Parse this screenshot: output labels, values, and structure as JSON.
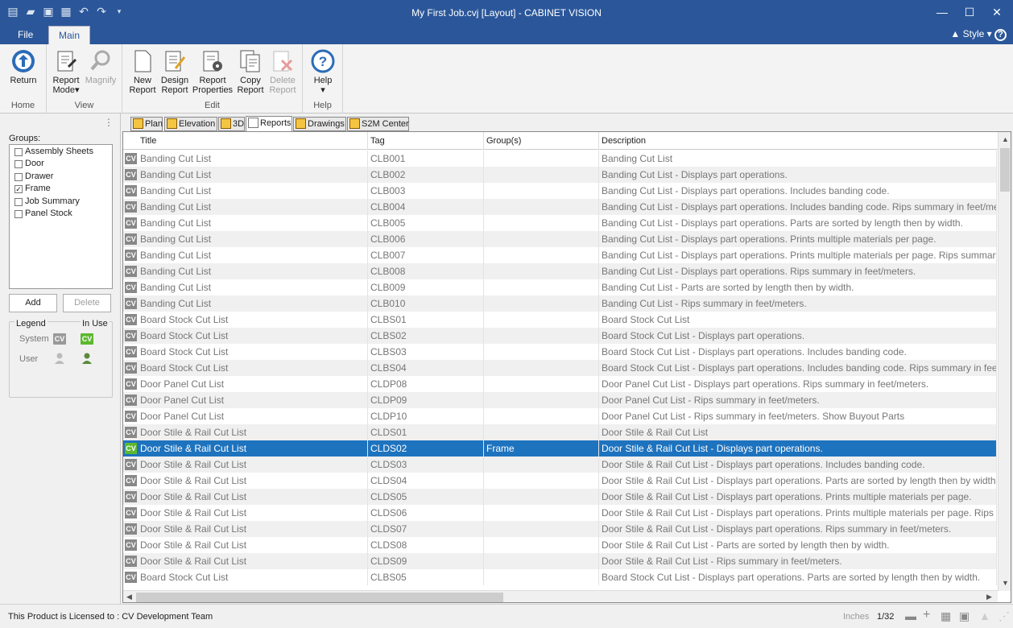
{
  "window": {
    "title": "My First Job.cvj [Layout] - CABINET VISION",
    "qat_icons": [
      "new-icon",
      "open-icon",
      "save-icon",
      "print-icon",
      "undo-icon",
      "redo-icon",
      "customize-icon"
    ],
    "controls": {
      "minimize": "—",
      "maximize": "☐",
      "close": "✕"
    }
  },
  "ribbon_tabs": [
    "File",
    "Main"
  ],
  "style_label": "Style",
  "ribbon": {
    "home": {
      "label": "Home",
      "return": "Return"
    },
    "view": {
      "label": "View",
      "report_mode_1": "Report",
      "report_mode_2": "Mode",
      "magnify": "Magnify"
    },
    "edit": {
      "label": "Edit",
      "new_1": "New",
      "new_2": "Report",
      "design_1": "Design",
      "design_2": "Report",
      "props_1": "Report",
      "props_2": "Properties",
      "copy_1": "Copy",
      "copy_2": "Report",
      "delete_1": "Delete",
      "delete_2": "Report"
    },
    "help": {
      "label": "Help",
      "help": "Help"
    }
  },
  "sidebar": {
    "groups_label": "Groups:",
    "groups": [
      {
        "label": "Assembly Sheets",
        "checked": false
      },
      {
        "label": "Door",
        "checked": false
      },
      {
        "label": "Drawer",
        "checked": false
      },
      {
        "label": "Frame",
        "checked": true
      },
      {
        "label": "Job Summary",
        "checked": false
      },
      {
        "label": "Panel Stock",
        "checked": false
      }
    ],
    "add": "Add",
    "delete": "Delete",
    "legend": {
      "title": "Legend",
      "in_use": "In Use",
      "system": "System",
      "user": "User",
      "cv": "CV"
    }
  },
  "view_tabs": [
    "Plan",
    "Elevation",
    "3D",
    "Reports",
    "Drawings",
    "S2M Center"
  ],
  "table": {
    "columns": [
      "Title",
      "Tag",
      "Group(s)",
      "Description"
    ],
    "rows": [
      {
        "title": "Banding Cut List",
        "tag": "CLB001",
        "group": "",
        "desc": "Banding Cut List"
      },
      {
        "title": "Banding Cut List",
        "tag": "CLB002",
        "group": "",
        "desc": "Banding Cut List - Displays part operations."
      },
      {
        "title": "Banding Cut List",
        "tag": "CLB003",
        "group": "",
        "desc": "Banding Cut List - Displays part operations.  Includes banding code."
      },
      {
        "title": "Banding Cut List",
        "tag": "CLB004",
        "group": "",
        "desc": "Banding Cut List - Displays part operations.  Includes banding code. Rips summary in feet/met"
      },
      {
        "title": "Banding Cut List",
        "tag": "CLB005",
        "group": "",
        "desc": "Banding Cut List - Displays part operations.  Parts are sorted by length then by width."
      },
      {
        "title": "Banding Cut List",
        "tag": "CLB006",
        "group": "",
        "desc": "Banding Cut List - Displays part operations.  Prints multiple materials per page."
      },
      {
        "title": "Banding Cut List",
        "tag": "CLB007",
        "group": "",
        "desc": "Banding Cut List - Displays part operations.  Prints multiple materials per page. Rips summary"
      },
      {
        "title": "Banding Cut List",
        "tag": "CLB008",
        "group": "",
        "desc": "Banding Cut List - Displays part operations. Rips summary in feet/meters."
      },
      {
        "title": "Banding Cut List",
        "tag": "CLB009",
        "group": "",
        "desc": "Banding Cut List - Parts are sorted by length then by width."
      },
      {
        "title": "Banding Cut List",
        "tag": "CLB010",
        "group": "",
        "desc": "Banding Cut List - Rips summary in feet/meters."
      },
      {
        "title": "Board Stock Cut List",
        "tag": "CLBS01",
        "group": "",
        "desc": "Board Stock Cut List"
      },
      {
        "title": "Board Stock Cut List",
        "tag": "CLBS02",
        "group": "",
        "desc": "Board Stock Cut List - Displays part operations."
      },
      {
        "title": "Board Stock Cut List",
        "tag": "CLBS03",
        "group": "",
        "desc": "Board Stock Cut List - Displays part operations.  Includes banding code."
      },
      {
        "title": "Board Stock Cut List",
        "tag": "CLBS04",
        "group": "",
        "desc": "Board Stock Cut List - Displays part operations.  Includes banding code. Rips summary in feet/"
      },
      {
        "title": "Door Panel Cut List",
        "tag": "CLDP08",
        "group": "",
        "desc": "Door Panel Cut List - Displays part operations. Rips summary in feet/meters."
      },
      {
        "title": "Door Panel Cut List",
        "tag": "CLDP09",
        "group": "",
        "desc": "Door Panel Cut List - Rips summary in feet/meters."
      },
      {
        "title": "Door Panel Cut List",
        "tag": "CLDP10",
        "group": "",
        "desc": "Door Panel Cut List - Rips summary in feet/meters.  Show Buyout Parts"
      },
      {
        "title": "Door Stile & Rail Cut List",
        "tag": "CLDS01",
        "group": "",
        "desc": "Door Stile & Rail Cut List"
      },
      {
        "title": "Door Stile & Rail Cut List",
        "tag": "CLDS02",
        "group": "Frame",
        "desc": "Door Stile & Rail Cut List - Displays part operations.",
        "selected": true
      },
      {
        "title": "Door Stile & Rail Cut List",
        "tag": "CLDS03",
        "group": "",
        "desc": "Door Stile & Rail Cut List - Displays part operations.  Includes banding code."
      },
      {
        "title": "Door Stile & Rail Cut List",
        "tag": "CLDS04",
        "group": "",
        "desc": "Door Stile & Rail Cut List - Displays part operations.  Parts are sorted by length then by width."
      },
      {
        "title": "Door Stile & Rail Cut List",
        "tag": "CLDS05",
        "group": "",
        "desc": "Door Stile & Rail Cut List - Displays part operations.  Prints multiple materials per page."
      },
      {
        "title": "Door Stile & Rail Cut List",
        "tag": "CLDS06",
        "group": "",
        "desc": "Door Stile & Rail Cut List - Displays part operations.  Prints multiple materials per page. Rips s"
      },
      {
        "title": "Door Stile & Rail Cut List",
        "tag": "CLDS07",
        "group": "",
        "desc": "Door Stile & Rail Cut List - Displays part operations. Rips summary in feet/meters."
      },
      {
        "title": "Door Stile & Rail Cut List",
        "tag": "CLDS08",
        "group": "",
        "desc": "Door Stile & Rail Cut List - Parts are sorted by length then by width."
      },
      {
        "title": "Door Stile & Rail Cut List",
        "tag": "CLDS09",
        "group": "",
        "desc": "Door Stile & Rail Cut List - Rips summary in feet/meters."
      },
      {
        "title": "Board Stock Cut List",
        "tag": "CLBS05",
        "group": "",
        "desc": "Board Stock Cut List - Displays part operations.  Parts are sorted by length then by width."
      }
    ],
    "cv": "CV"
  },
  "status": {
    "license": "This Product is Licensed to : CV Development Team",
    "units": "Inches",
    "scale": "1/32"
  },
  "colors": {
    "accent": "#2b579a",
    "selection": "#1e73be",
    "in_use": "#5cb82e"
  }
}
